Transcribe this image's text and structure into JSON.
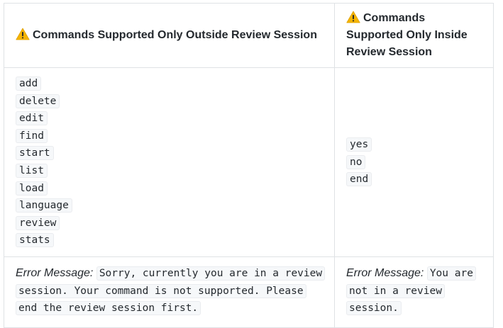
{
  "table": {
    "headers": [
      "Commands Supported Only Outside Review Session",
      "Commands Supported Only Inside Review Session"
    ],
    "warning_icon": "warning-icon",
    "outside_commands": [
      "add",
      "delete",
      "edit",
      "find",
      "start",
      "list",
      "load",
      "language",
      "review",
      "stats"
    ],
    "inside_commands": [
      "yes",
      "no",
      "end"
    ],
    "error_label": "Error Message:",
    "outside_error": "Sorry, currently you are in a review session. Your command is not supported. Please end the review session first.",
    "inside_error": "You are not in a review session."
  },
  "colors": {
    "border": "#dfe2e5",
    "code_bg": "#f6f8fa",
    "warning": "#f5b400"
  }
}
